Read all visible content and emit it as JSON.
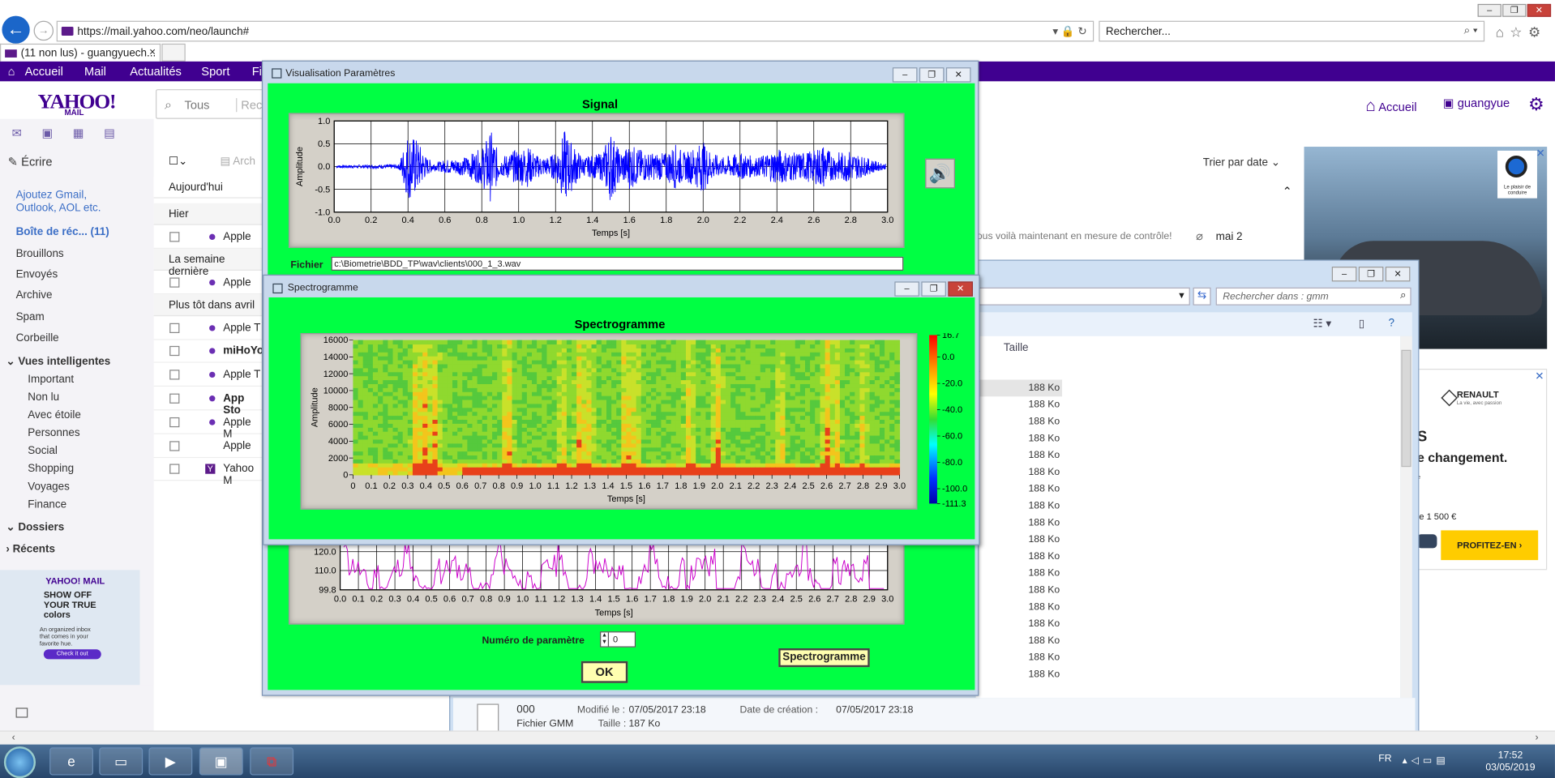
{
  "browser": {
    "url": "https://mail.yahoo.com/neo/launch#",
    "search_placeholder": "Rechercher...",
    "tab_title": "(11 non lus) - guangyuech...",
    "tab_close": "×"
  },
  "yahoo_nav": [
    "Accueil",
    "Mail",
    "Actualités",
    "Sport",
    "Fi"
  ],
  "yahoo": {
    "logo": "YAHOO!",
    "logo_sub": "MAIL",
    "search_scope": "Tous",
    "search_placeholder": "Rech",
    "home": "Accueil",
    "user": "guangyue"
  },
  "sidebar": {
    "compose": "Écrire",
    "add_accounts": "Ajoutez Gmail, Outlook, AOL etc.",
    "inbox": "Boîte de réc... (11)",
    "folders": [
      "Brouillons",
      "Envoyés",
      "Archive",
      "Spam",
      "Corbeille"
    ],
    "smart_views_header": "Vues intelligentes",
    "smart_views": [
      "Important",
      "Non lu",
      "Avec étoile",
      "Personnes",
      "Social",
      "Shopping",
      "Voyages",
      "Finance"
    ],
    "dossiers": "Dossiers",
    "recents": "Récents"
  },
  "promo": {
    "brand": "YAHOO! MAIL",
    "headline": "SHOW OFF YOUR TRUE colors",
    "text": "An organized inbox that comes in your favorite hue.",
    "button": "Check it out"
  },
  "mail_list": {
    "archive_label": "Arch",
    "sort": "Trier par date ⌄",
    "groups": [
      {
        "label": "Aujourd'hui"
      },
      {
        "label": "Hier"
      },
      {
        "label": "La semaine dernière"
      },
      {
        "label": "Plus tôt dans avril"
      }
    ],
    "rows": [
      {
        "sender": "Apple"
      },
      {
        "sender": "Apple"
      },
      {
        "sender": "Apple T"
      },
      {
        "sender": "miHoYo"
      },
      {
        "sender": "Apple T"
      },
      {
        "sender": "App Sto"
      },
      {
        "sender": "Apple M"
      },
      {
        "sender": "Apple"
      },
      {
        "sender": "Yahoo M"
      }
    ],
    "snippet": "ous voilà maintenant en mesure de contrôle!",
    "date": "mai 2"
  },
  "ads": {
    "bmw_tagline": "Le plaisir de conduire",
    "renault_name": "RENAULT",
    "renault_slogan": "La vie, avec passion",
    "renault_headline": "S",
    "renault_text": "e changement.",
    "renault_e": "e",
    "renault_price": "le 1 500 €",
    "renault_button": "PROFITEZ-EN"
  },
  "explorer": {
    "search_placeholder": "Rechercher dans : gmm",
    "column": "Taille",
    "sizes": [
      "188 Ko",
      "188 Ko",
      "188 Ko",
      "188 Ko",
      "188 Ko",
      "188 Ko",
      "188 Ko",
      "188 Ko",
      "188 Ko",
      "188 Ko",
      "188 Ko",
      "188 Ko",
      "188 Ko",
      "188 Ko",
      "188 Ko",
      "188 Ko",
      "188 Ko",
      "188 Ko"
    ],
    "s_mark": "s",
    "detail": {
      "name": "000",
      "type": "Fichier GMM",
      "modified_label": "Modifié le :",
      "modified": "07/05/2017 23:18",
      "size_label": "Taille :",
      "size": "187 Ko",
      "created_label": "Date de création :",
      "created": "07/05/2017 23:18"
    }
  },
  "visu_window": {
    "title": "Visualisation Paramètres",
    "signal_title": "Signal",
    "fichier_label": "Fichier",
    "fichier_value": "c:\\Biometrie\\BDD_TP\\wav\\clients\\000_1_3.wav",
    "param_label": "Numéro de paramètre",
    "param_value": "0",
    "ok": "OK",
    "spectro_button": "Spectrogramme"
  },
  "spectro_window": {
    "title": "Spectrogramme",
    "chart_title": "Spectrogramme"
  },
  "chart_data": [
    {
      "type": "line",
      "title": "Signal",
      "xlabel": "Temps [s]",
      "ylabel": "Amplitude",
      "xlim": [
        0,
        3
      ],
      "ylim": [
        -1,
        1
      ],
      "x_ticks": [
        "0.0",
        "0.2",
        "0.4",
        "0.6",
        "0.8",
        "1.0",
        "1.2",
        "1.4",
        "1.6",
        "1.8",
        "2.0",
        "2.2",
        "2.4",
        "2.6",
        "2.8",
        "3.0"
      ],
      "y_ticks": [
        "1.0",
        "0.5",
        "0.0",
        "-0.5",
        "-1.0"
      ],
      "color": "#0000ff",
      "envelope": [
        [
          0.0,
          0.03
        ],
        [
          0.35,
          0.05
        ],
        [
          0.4,
          0.75
        ],
        [
          0.45,
          0.6
        ],
        [
          0.5,
          0.2
        ],
        [
          0.55,
          0.08
        ],
        [
          0.6,
          0.15
        ],
        [
          0.7,
          0.2
        ],
        [
          0.8,
          0.4
        ],
        [
          0.85,
          0.8
        ],
        [
          0.9,
          0.2
        ],
        [
          1.0,
          0.4
        ],
        [
          1.05,
          0.45
        ],
        [
          1.1,
          0.25
        ],
        [
          1.15,
          0.2
        ],
        [
          1.2,
          0.3
        ],
        [
          1.25,
          0.8
        ],
        [
          1.3,
          0.45
        ],
        [
          1.35,
          0.2
        ],
        [
          1.45,
          0.3
        ],
        [
          1.5,
          0.8
        ],
        [
          1.55,
          0.3
        ],
        [
          1.6,
          0.5
        ],
        [
          1.7,
          0.3
        ],
        [
          1.8,
          0.3
        ],
        [
          1.85,
          0.5
        ],
        [
          1.9,
          0.3
        ],
        [
          2.0,
          0.55
        ],
        [
          2.05,
          0.3
        ],
        [
          2.1,
          0.2
        ],
        [
          2.2,
          0.3
        ],
        [
          2.3,
          0.2
        ],
        [
          2.35,
          0.3
        ],
        [
          2.4,
          0.4
        ],
        [
          2.5,
          0.3
        ],
        [
          2.6,
          0.35
        ],
        [
          2.65,
          0.5
        ],
        [
          2.7,
          0.3
        ],
        [
          2.8,
          0.35
        ],
        [
          2.85,
          0.25
        ],
        [
          2.95,
          0.1
        ],
        [
          3.0,
          0.05
        ]
      ]
    },
    {
      "type": "heatmap",
      "title": "Spectrogramme",
      "xlabel": "Temps [s]",
      "ylabel": "Amplitude",
      "xlim": [
        0,
        3
      ],
      "ylim": [
        0,
        16000
      ],
      "x_ticks": [
        "0",
        "0.1",
        "0.2",
        "0.3",
        "0.4",
        "0.5",
        "0.6",
        "0.7",
        "0.8",
        "0.9",
        "1.0",
        "1.1",
        "1.2",
        "1.3",
        "1.4",
        "1.5",
        "1.6",
        "1.7",
        "1.8",
        "1.9",
        "2.0",
        "2.1",
        "2.2",
        "2.3",
        "2.4",
        "2.5",
        "2.6",
        "2.7",
        "2.8",
        "2.9",
        "3.0"
      ],
      "y_ticks": [
        "16000",
        "14000",
        "12000",
        "10000",
        "8000",
        "6000",
        "4000",
        "2000",
        "0"
      ],
      "colorbar": {
        "max": 16.7,
        "min": -111.3,
        "ticks": [
          "16.7",
          "0.0",
          "-20.0",
          "-40.0",
          "-60.0",
          "-80.0",
          "-100.0",
          "-111.3"
        ]
      },
      "energy": [
        [
          0.35,
          0.9
        ],
        [
          0.4,
          1.0
        ],
        [
          0.45,
          0.8
        ],
        [
          0.85,
          1.0
        ],
        [
          1.15,
          0.6
        ],
        [
          1.25,
          1.0
        ],
        [
          1.3,
          0.6
        ],
        [
          1.5,
          1.0
        ],
        [
          1.55,
          0.7
        ],
        [
          1.85,
          0.8
        ],
        [
          2.0,
          0.9
        ],
        [
          2.35,
          0.6
        ],
        [
          2.6,
          1.0
        ],
        [
          2.65,
          0.8
        ],
        [
          2.8,
          0.6
        ]
      ]
    },
    {
      "type": "line",
      "xlabel": "Temps [s]",
      "xlim": [
        0,
        3
      ],
      "ylim": [
        99.8,
        125
      ],
      "x_ticks": [
        "0.0",
        "0.1",
        "0.2",
        "0.3",
        "0.4",
        "0.5",
        "0.6",
        "0.7",
        "0.8",
        "0.9",
        "1.0",
        "1.1",
        "1.2",
        "1.3",
        "1.4",
        "1.5",
        "1.6",
        "1.7",
        "1.8",
        "1.9",
        "2.0",
        "2.1",
        "2.2",
        "2.3",
        "2.4",
        "2.5",
        "2.6",
        "2.7",
        "2.8",
        "2.9",
        "3.0"
      ],
      "y_ticks": [
        "120.0",
        "110.0",
        "99.8"
      ],
      "color": "#cc00cc"
    }
  ],
  "taskbar": {
    "lang": "FR",
    "time": "17:52",
    "date": "03/05/2019"
  },
  "colors": {
    "yahoo_purple": "#400090",
    "lab_green": "#00ff43",
    "signal_blue": "#0000ff"
  }
}
